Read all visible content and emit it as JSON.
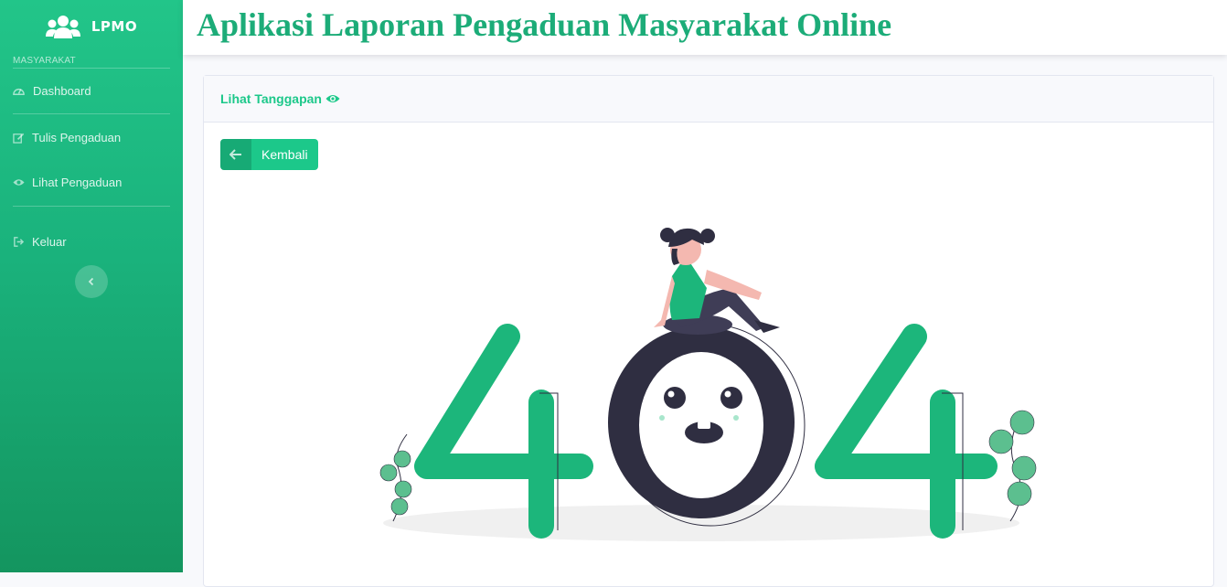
{
  "sidebar": {
    "brand": "LPMO",
    "heading": "MASYARAKAT",
    "items": [
      {
        "label": "Dashboard",
        "icon": "dashboard-icon"
      },
      {
        "label": "Tulis Pengaduan",
        "icon": "edit-icon"
      },
      {
        "label": "Lihat Pengaduan",
        "icon": "eye-icon"
      },
      {
        "label": "Keluar",
        "icon": "sign-out-icon"
      }
    ],
    "toggle_icon": "chevron-left-icon"
  },
  "header": {
    "title": "Aplikasi Laporan Pengaduan Masyarakat Online"
  },
  "card": {
    "title": "Lihat Tanggapan",
    "back_button": "Kembali"
  },
  "colors": {
    "primary": "#1cc88a",
    "dark": "#2f2e41"
  }
}
